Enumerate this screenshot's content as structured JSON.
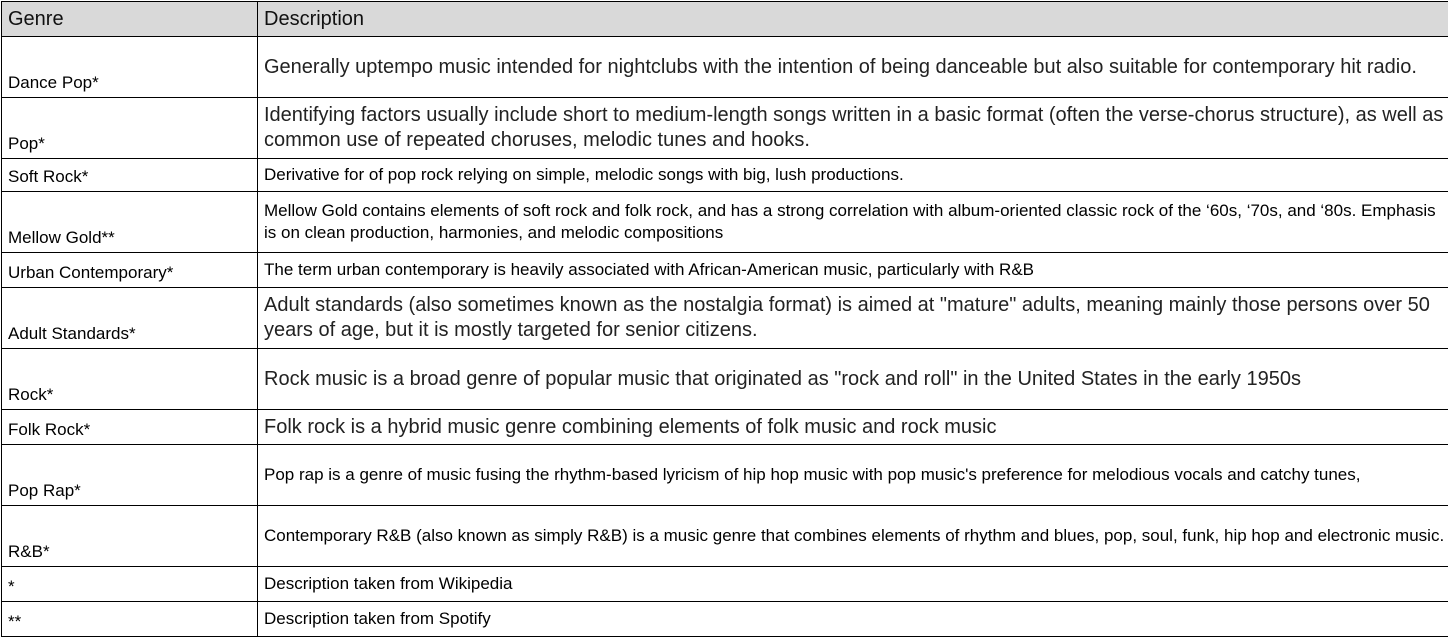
{
  "table": {
    "headers": [
      "Genre",
      "Description"
    ],
    "rows": [
      {
        "genre": "Dance Pop*",
        "description": "Generally uptempo music intended for nightclubs with the intention of being danceable but also suitable for contemporary hit radio."
      },
      {
        "genre": "Pop*",
        "description": "Identifying factors usually include short to medium-length songs written in a basic format (often the verse-chorus structure), as well as common use of repeated choruses, melodic tunes and hooks."
      },
      {
        "genre": "Soft Rock*",
        "description": "Derivative for of pop rock relying on simple, melodic songs with big, lush productions."
      },
      {
        "genre": "Mellow Gold**",
        "description": "Mellow Gold contains elements of soft rock and folk rock, and has a strong correlation with album-oriented classic rock of the ‘60s, ‘70s, and ‘80s. Emphasis is on clean production, harmonies, and melodic compositions"
      },
      {
        "genre": "Urban Contemporary*",
        "description": "The term urban contemporary is heavily associated with African-American music, particularly with R&B"
      },
      {
        "genre": "Adult Standards*",
        "description": "Adult standards (also sometimes known as the nostalgia format) is aimed at \"mature\" adults, meaning mainly those persons over 50 years of age, but it is mostly targeted for senior citizens."
      },
      {
        "genre": "Rock*",
        "description": "Rock music is a broad genre of popular music that originated as \"rock and roll\" in the United States in the early 1950s"
      },
      {
        "genre": "Folk Rock*",
        "description": "Folk rock is a hybrid music genre combining elements of folk music and rock music"
      },
      {
        "genre": "Pop Rap*",
        "description": "Pop rap is a genre of music fusing the rhythm-based lyricism of hip hop music with pop music's preference for melodious vocals and catchy tunes,"
      },
      {
        "genre": "R&B*",
        "description": "Contemporary R&B (also known as simply R&B) is a music genre that combines elements of rhythm and blues, pop, soul, funk, hip hop and electronic music."
      },
      {
        "genre": "*",
        "description": "Description taken from Wikipedia"
      },
      {
        "genre": "**",
        "description": "Description taken from Spotify"
      }
    ]
  }
}
